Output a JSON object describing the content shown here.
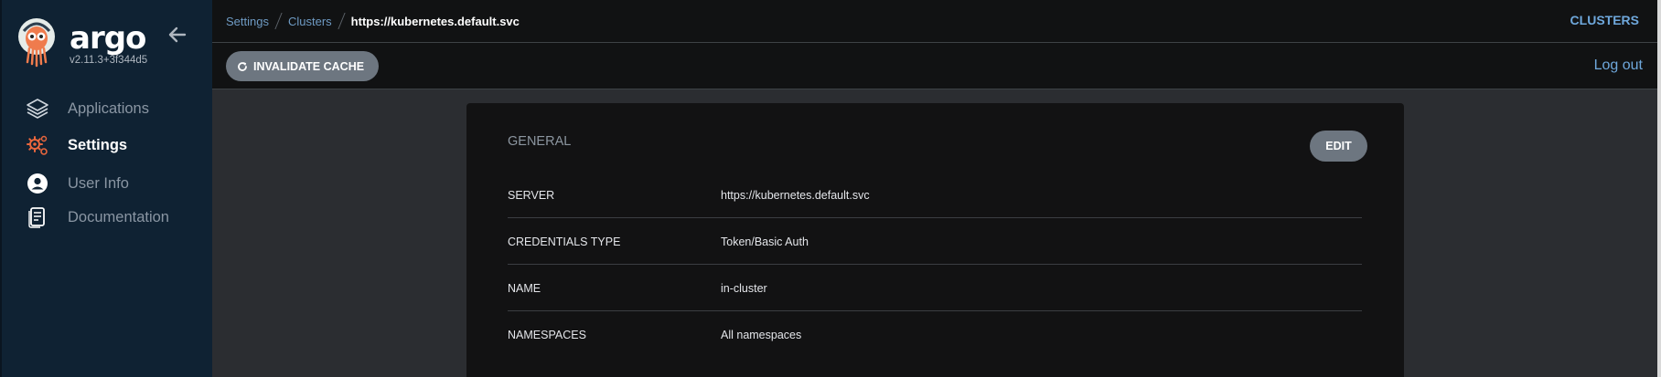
{
  "brand": {
    "name": "argo",
    "version": "v2.11.3+3f344d5"
  },
  "sidebar": {
    "items": [
      {
        "label": "Applications",
        "icon": "layers-icon",
        "active": false
      },
      {
        "label": "Settings",
        "icon": "gears-icon",
        "active": true
      },
      {
        "label": "User Info",
        "icon": "user-circle-icon",
        "active": false
      },
      {
        "label": "Documentation",
        "icon": "book-icon",
        "active": false
      }
    ]
  },
  "breadcrumb": {
    "items": [
      "Settings",
      "Clusters"
    ],
    "current": "https://kubernetes.default.svc"
  },
  "topbar": {
    "right_label": "CLUSTERS"
  },
  "actionbar": {
    "invalidate_label": "INVALIDATE CACHE",
    "logout_label": "Log out"
  },
  "card": {
    "title": "GENERAL",
    "edit_label": "EDIT",
    "rows": [
      {
        "key": "SERVER",
        "value": "https://kubernetes.default.svc"
      },
      {
        "key": "CREDENTIALS TYPE",
        "value": "Token/Basic Auth"
      },
      {
        "key": "NAME",
        "value": "in-cluster"
      },
      {
        "key": "NAMESPACES",
        "value": "All namespaces"
      }
    ]
  },
  "colors": {
    "sidebar_bg": "#0f2233",
    "accent_link": "#6fa8dc",
    "button_gray": "#6d7680",
    "settings_icon": "#e8663d"
  }
}
